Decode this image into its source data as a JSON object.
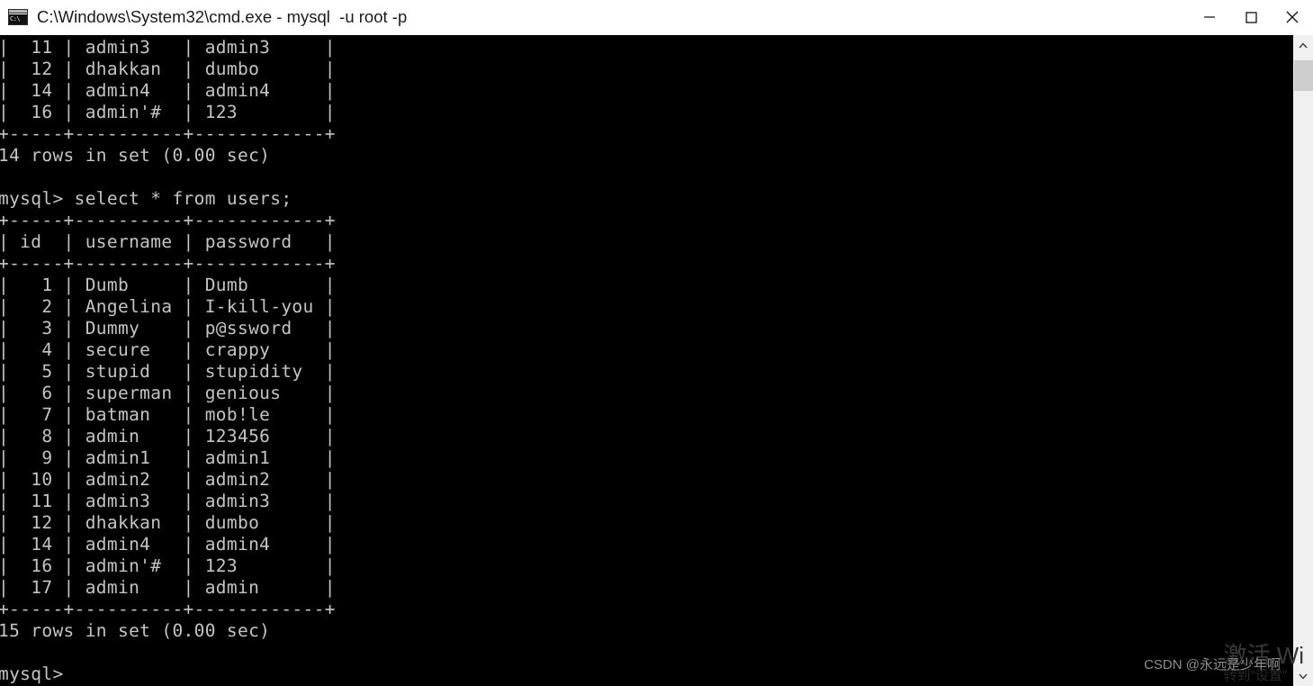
{
  "window": {
    "title": "C:\\Windows\\System32\\cmd.exe - mysql  -u root -p",
    "icon": "cmd-console-icon",
    "icon_text": "C:\\",
    "minimize_label": "Minimize",
    "maximize_label": "Maximize",
    "close_label": "Close",
    "titlebar_bg": "#ffffff",
    "titlebar_fg": "#1a1a1a"
  },
  "console": {
    "background": "#000000",
    "foreground": "#c4c4c4",
    "prompt": "mysql>",
    "previous_result": {
      "rows_visible": [
        {
          "id": "11",
          "username": "admin3",
          "password": "admin3"
        },
        {
          "id": "12",
          "username": "dhakkan",
          "password": "dumbo"
        },
        {
          "id": "14",
          "username": "admin4",
          "password": "admin4"
        },
        {
          "id": "16",
          "username": "admin'#",
          "password": "123"
        }
      ],
      "status": "14 rows in set (0.00 sec)"
    },
    "command": "select * from users;",
    "command_line": "mysql> select * from users;",
    "table": {
      "border": "+----+----------+------------+",
      "columns": [
        "id",
        "username",
        "password"
      ],
      "rows": [
        {
          "id": "1",
          "username": "Dumb",
          "password": "Dumb"
        },
        {
          "id": "2",
          "username": "Angelina",
          "password": "I-kill-you"
        },
        {
          "id": "3",
          "username": "Dummy",
          "password": "p@ssword"
        },
        {
          "id": "4",
          "username": "secure",
          "password": "crappy"
        },
        {
          "id": "5",
          "username": "stupid",
          "password": "stupidity"
        },
        {
          "id": "6",
          "username": "superman",
          "password": "genious"
        },
        {
          "id": "7",
          "username": "batman",
          "password": "mob!le"
        },
        {
          "id": "8",
          "username": "admin",
          "password": "123456"
        },
        {
          "id": "9",
          "username": "admin1",
          "password": "admin1"
        },
        {
          "id": "10",
          "username": "admin2",
          "password": "admin2"
        },
        {
          "id": "11",
          "username": "admin3",
          "password": "admin3"
        },
        {
          "id": "12",
          "username": "dhakkan",
          "password": "dumbo"
        },
        {
          "id": "14",
          "username": "admin4",
          "password": "admin4"
        },
        {
          "id": "16",
          "username": "admin'#",
          "password": "123"
        },
        {
          "id": "17",
          "username": "admin",
          "password": "admin"
        }
      ],
      "status": "15 rows in set (0.00 sec)"
    },
    "screen_text": "|  11 | admin3   | admin3     |\n|  12 | dhakkan  | dumbo      |\n|  14 | admin4   | admin4     |\n|  16 | admin'#  | 123        |\n+-----+----------+------------+\n14 rows in set (0.00 sec)\n\nmysql> select * from users;\n+-----+----------+------------+\n| id  | username | password   |\n+-----+----------+------------+\n|   1 | Dumb     | Dumb       |\n|   2 | Angelina | I-kill-you |\n|   3 | Dummy    | p@ssword   |\n|   4 | secure   | crappy     |\n|   5 | stupid   | stupidity  |\n|   6 | superman | genious    |\n|   7 | batman   | mob!le     |\n|   8 | admin    | 123456     |\n|   9 | admin1   | admin1     |\n|  10 | admin2   | admin2     |\n|  11 | admin3   | admin3     |\n|  12 | dhakkan  | dumbo      |\n|  14 | admin4   | admin4     |\n|  16 | admin'#  | 123        |\n|  17 | admin    | admin      |\n+-----+----------+------------+\n15 rows in set (0.00 sec)\n\nmysql>"
  },
  "scrollbar": {
    "up_arrow": "chevron-up-icon",
    "down_arrow": "chevron-down-icon",
    "thumb_position": "top"
  },
  "watermarks": {
    "csdn": "CSDN @永远是少年啊",
    "activate_line1": "激活 Wi",
    "activate_line2": "转到\"设置\""
  }
}
